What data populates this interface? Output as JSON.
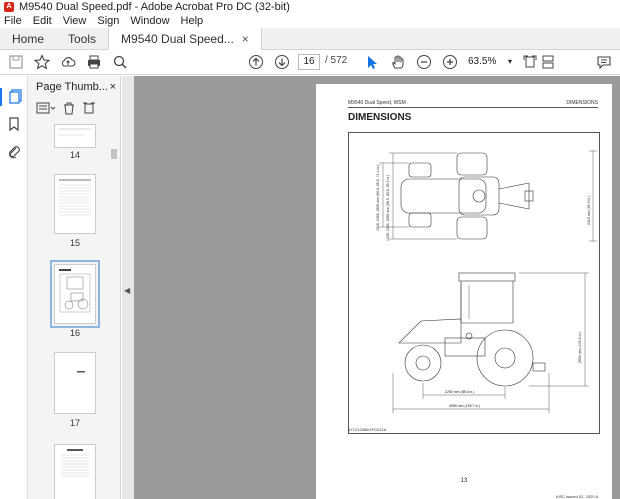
{
  "window": {
    "title": "M9540 Dual Speed.pdf - Adobe Acrobat Pro DC (32-bit)"
  },
  "menu": [
    "File",
    "Edit",
    "View",
    "Sign",
    "Window",
    "Help"
  ],
  "tabs": {
    "home": "Home",
    "tools": "Tools",
    "document": "M9540 Dual Speed..."
  },
  "toolbar": {
    "current_page": "16",
    "page_count": "/ 572",
    "zoom": "63.5%"
  },
  "panel": {
    "title": "Page Thumb...",
    "pages": [
      "14",
      "15",
      "16",
      "17"
    ]
  },
  "document": {
    "header_left": "M9540 Dual Speed, WSM",
    "header_right": "DIMENSIONS",
    "title": "DIMENSIONS",
    "dims": {
      "front_tread": "1540, 1665, 1805 mm (60.6, 65.6, 71.1 in.)",
      "rear_tread": "1435, 1545, 1655 mm (56.5, 60.8, 65.2 in.)",
      "width": "2410 mm (94.9 in.)",
      "height": "2650 mm (104.3 in.)",
      "wheelbase": "2250 mm (88.6 in.)",
      "length": "3955 mm (155.7 in.)"
    },
    "fig_id": "9Y1210388GFG021A",
    "page_number": "13",
    "footer": "KiSC issued 02, 2020 A"
  }
}
